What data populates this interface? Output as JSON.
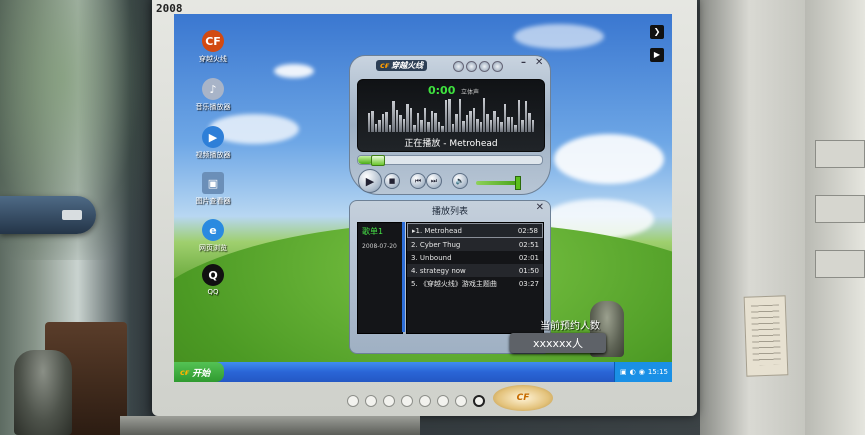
{
  "monitor": {
    "year": "2008"
  },
  "desktop_icons": [
    {
      "label": "穿越火线",
      "icon": "crossfire-icon",
      "glyph": "CF",
      "color": "#d24a12"
    },
    {
      "label": "音乐播放器",
      "icon": "music-player-icon",
      "glyph": "♪",
      "color": "#a8b4c8"
    },
    {
      "label": "视频播放器",
      "icon": "video-player-icon",
      "glyph": "▶",
      "color": "#2e7fd8"
    },
    {
      "label": "图片查看器",
      "icon": "image-viewer-icon",
      "glyph": "▣",
      "color": "#6b8fb8"
    },
    {
      "label": "网页浏览",
      "icon": "ie-browser-icon",
      "glyph": "e",
      "color": "#2a8ae0"
    },
    {
      "label": "QQ",
      "icon": "qq-icon",
      "glyph": "Q",
      "color": "#111111"
    }
  ],
  "player": {
    "title": "穿越火线",
    "time": "0:00",
    "mode": "立体声",
    "now_playing": "正在播放 - Metrohead",
    "progress_fraction": 0.08,
    "volume_fraction": 0.92
  },
  "playlist": {
    "title": "播放列表",
    "list_name": "歌单1",
    "list_date": "2008-07-20",
    "tracks": [
      {
        "title": "1. Metrohead",
        "duration": "02:58",
        "active": true
      },
      {
        "title": "2. Cyber Thug",
        "duration": "02:51"
      },
      {
        "title": "3. Unbound",
        "duration": "02:01"
      },
      {
        "title": "4. strategy now",
        "duration": "01:50"
      },
      {
        "title": "5. 《穿越火线》游戏主题曲",
        "duration": "03:27"
      }
    ]
  },
  "reservation": {
    "label": "当前预约人数",
    "value": "xxxxxx人"
  },
  "taskbar": {
    "start_label": "开始",
    "clock": "15:15"
  },
  "colors": {
    "accent_green": "#46e046",
    "taskbar_blue": "#2a65d6",
    "start_green": "#2f9a2f"
  }
}
